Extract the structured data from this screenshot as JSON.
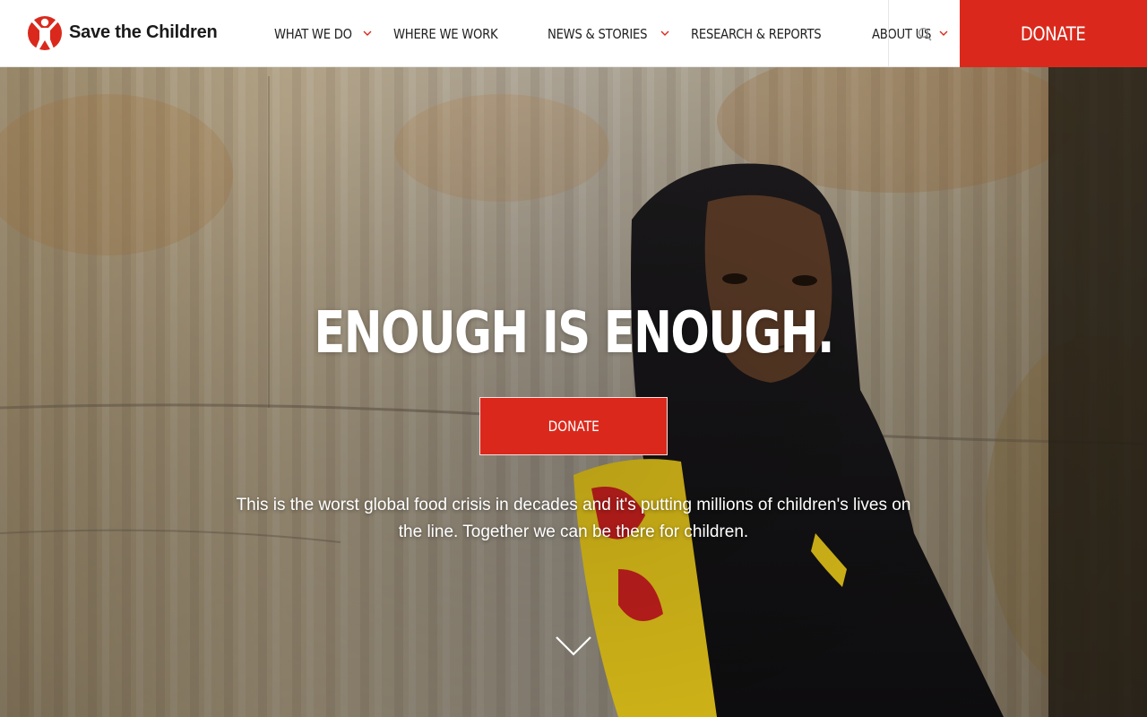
{
  "brand": {
    "name": "Save the Children",
    "red": "#da291c",
    "text_dark": "#222222"
  },
  "nav": {
    "items": [
      {
        "label": "WHAT WE DO",
        "has_dropdown": true
      },
      {
        "label": "WHERE WE WORK",
        "has_dropdown": false
      },
      {
        "label": "NEWS & STORIES",
        "has_dropdown": true
      },
      {
        "label": "RESEARCH & REPORTS",
        "has_dropdown": false
      },
      {
        "label": "ABOUT US",
        "has_dropdown": true
      }
    ],
    "search_icon": "search-icon",
    "dropdown_icon": "chevron-down-icon",
    "donate_label": "DONATE"
  },
  "hero": {
    "title": "ENOUGH IS ENOUGH.",
    "donate_label": "DONATE",
    "text": "This is the worst global food crisis in decades and it's putting millions of children's lives on the line. Together we can be there for children.",
    "scroll_icon": "chevron-down-icon"
  }
}
